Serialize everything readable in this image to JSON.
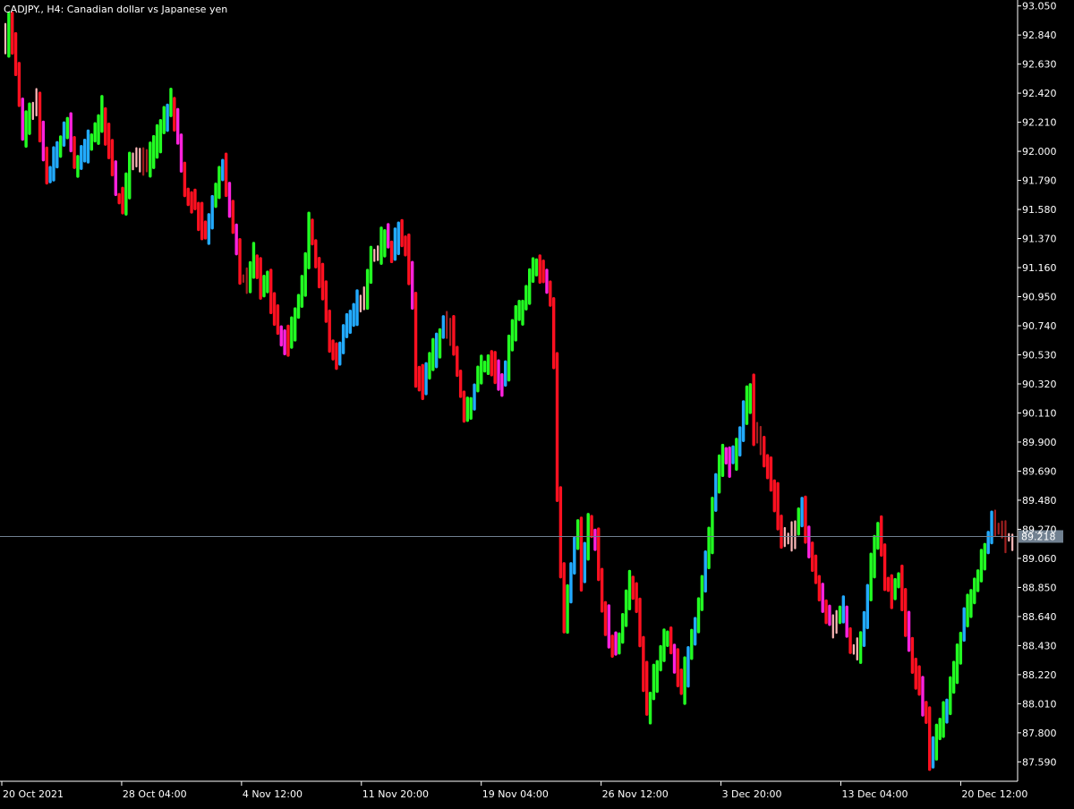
{
  "chart_title": {
    "symbol": "CADJPY.",
    "timeframe": "H4:",
    "description": "Canadian dollar vs Japanese yen"
  },
  "colors": {
    "background": "#000000",
    "axis": "#ffffff",
    "text": "#ffffff",
    "price_line": "#708090",
    "price_tag_bg": "#708090",
    "strong_up": "#22ff22",
    "weak_up": "#22aaff",
    "strong_down": "#ff1020",
    "weak_down": "#ff22dd",
    "bull_body": "#ffb9b9",
    "bear_body": "#a02020"
  },
  "chart_data": {
    "type": "candlestick",
    "ylim": [
      87.45,
      93.08
    ],
    "y_ticks": [
      "93.050",
      "92.840",
      "92.630",
      "92.420",
      "92.210",
      "92.000",
      "91.790",
      "91.580",
      "91.370",
      "91.160",
      "90.950",
      "90.740",
      "90.530",
      "90.320",
      "90.110",
      "89.900",
      "89.690",
      "89.480",
      "89.270",
      "89.060",
      "88.850",
      "88.640",
      "88.430",
      "88.220",
      "88.010",
      "87.800",
      "87.590"
    ],
    "x_ticks": [
      "20 Oct 2021",
      "28 Oct 04:00",
      "4 Nov 12:00",
      "11 Nov 20:00",
      "19 Nov 04:00",
      "26 Nov 12:00",
      "3 Dec 20:00",
      "13 Dec 04:00",
      "20 Dec 12:00"
    ],
    "current_price": "89.218",
    "close_anchors": [
      [
        0,
        92.8
      ],
      [
        1,
        92.95
      ],
      [
        3,
        92.6
      ],
      [
        5,
        92.1
      ],
      [
        7,
        92.3
      ],
      [
        9,
        92.35
      ],
      [
        12,
        91.8
      ],
      [
        15,
        92.0
      ],
      [
        18,
        92.2
      ],
      [
        20,
        91.9
      ],
      [
        23,
        92.0
      ],
      [
        26,
        92.15
      ],
      [
        28,
        92.3
      ],
      [
        29,
        92.1
      ],
      [
        31,
        91.9
      ],
      [
        32,
        91.7
      ],
      [
        34,
        91.6
      ],
      [
        36,
        91.9
      ],
      [
        39,
        91.95
      ],
      [
        41,
        91.9
      ],
      [
        44,
        92.1
      ],
      [
        46,
        92.25
      ],
      [
        48,
        92.35
      ],
      [
        50,
        92.1
      ],
      [
        52,
        91.7
      ],
      [
        55,
        91.6
      ],
      [
        58,
        91.4
      ],
      [
        61,
        91.75
      ],
      [
        63,
        91.9
      ],
      [
        65,
        91.6
      ],
      [
        67,
        91.3
      ],
      [
        68,
        91.1
      ],
      [
        70,
        91.05
      ],
      [
        72,
        91.25
      ],
      [
        74,
        91.0
      ],
      [
        76,
        91.1
      ],
      [
        77,
        90.9
      ],
      [
        79,
        90.7
      ],
      [
        82,
        90.6
      ],
      [
        84,
        90.8
      ],
      [
        86,
        91.0
      ],
      [
        88,
        91.5
      ],
      [
        90,
        91.2
      ],
      [
        92,
        91.0
      ],
      [
        94,
        90.6
      ],
      [
        96,
        90.5
      ],
      [
        98,
        90.7
      ],
      [
        100,
        90.8
      ],
      [
        102,
        90.9
      ],
      [
        104,
        90.95
      ],
      [
        106,
        91.25
      ],
      [
        108,
        91.3
      ],
      [
        110,
        91.4
      ],
      [
        112,
        91.3
      ],
      [
        114,
        91.45
      ],
      [
        116,
        91.3
      ],
      [
        118,
        90.9
      ],
      [
        119,
        90.4
      ],
      [
        121,
        90.3
      ],
      [
        123,
        90.5
      ],
      [
        125,
        90.6
      ],
      [
        127,
        90.75
      ],
      [
        129,
        90.7
      ],
      [
        131,
        90.4
      ],
      [
        133,
        90.1
      ],
      [
        135,
        90.2
      ],
      [
        137,
        90.4
      ],
      [
        140,
        90.5
      ],
      [
        142,
        90.4
      ],
      [
        144,
        90.3
      ],
      [
        146,
        90.6
      ],
      [
        148,
        90.8
      ],
      [
        150,
        90.9
      ],
      [
        152,
        91.1
      ],
      [
        154,
        91.2
      ],
      [
        156,
        91.1
      ],
      [
        158,
        90.9
      ],
      [
        159,
        90.5
      ],
      [
        160,
        89.5
      ],
      [
        161,
        89.0
      ],
      [
        162,
        88.6
      ],
      [
        164,
        89.0
      ],
      [
        166,
        89.3
      ],
      [
        167,
        88.9
      ],
      [
        169,
        89.3
      ],
      [
        171,
        89.2
      ],
      [
        173,
        88.7
      ],
      [
        175,
        88.5
      ],
      [
        177,
        88.4
      ],
      [
        179,
        88.6
      ],
      [
        181,
        88.9
      ],
      [
        183,
        88.7
      ],
      [
        185,
        88.2
      ],
      [
        186,
        87.95
      ],
      [
        188,
        88.2
      ],
      [
        190,
        88.4
      ],
      [
        192,
        88.5
      ],
      [
        194,
        88.3
      ],
      [
        196,
        88.1
      ],
      [
        198,
        88.4
      ],
      [
        200,
        88.6
      ],
      [
        202,
        88.9
      ],
      [
        204,
        89.2
      ],
      [
        206,
        89.6
      ],
      [
        208,
        89.85
      ],
      [
        210,
        89.75
      ],
      [
        212,
        89.85
      ],
      [
        214,
        90.1
      ],
      [
        216,
        90.3
      ],
      [
        217,
        89.95
      ],
      [
        219,
        89.9
      ],
      [
        221,
        89.7
      ],
      [
        223,
        89.5
      ],
      [
        225,
        89.2
      ],
      [
        227,
        89.2
      ],
      [
        229,
        89.25
      ],
      [
        231,
        89.4
      ],
      [
        233,
        89.1
      ],
      [
        235,
        88.9
      ],
      [
        237,
        88.7
      ],
      [
        239,
        88.6
      ],
      [
        241,
        88.6
      ],
      [
        243,
        88.7
      ],
      [
        245,
        88.4
      ],
      [
        247,
        88.4
      ],
      [
        249,
        88.6
      ],
      [
        251,
        89.0
      ],
      [
        253,
        89.3
      ],
      [
        255,
        88.9
      ],
      [
        257,
        88.8
      ],
      [
        259,
        88.9
      ],
      [
        261,
        88.6
      ],
      [
        263,
        88.3
      ],
      [
        265,
        88.1
      ],
      [
        267,
        87.9
      ],
      [
        268,
        87.6
      ],
      [
        270,
        87.8
      ],
      [
        272,
        87.95
      ],
      [
        274,
        88.1
      ],
      [
        276,
        88.4
      ],
      [
        278,
        88.6
      ],
      [
        280,
        88.8
      ],
      [
        282,
        88.9
      ],
      [
        284,
        89.15
      ],
      [
        286,
        89.3
      ],
      [
        288,
        89.25
      ],
      [
        290,
        89.2
      ],
      [
        292,
        89.218
      ]
    ]
  }
}
